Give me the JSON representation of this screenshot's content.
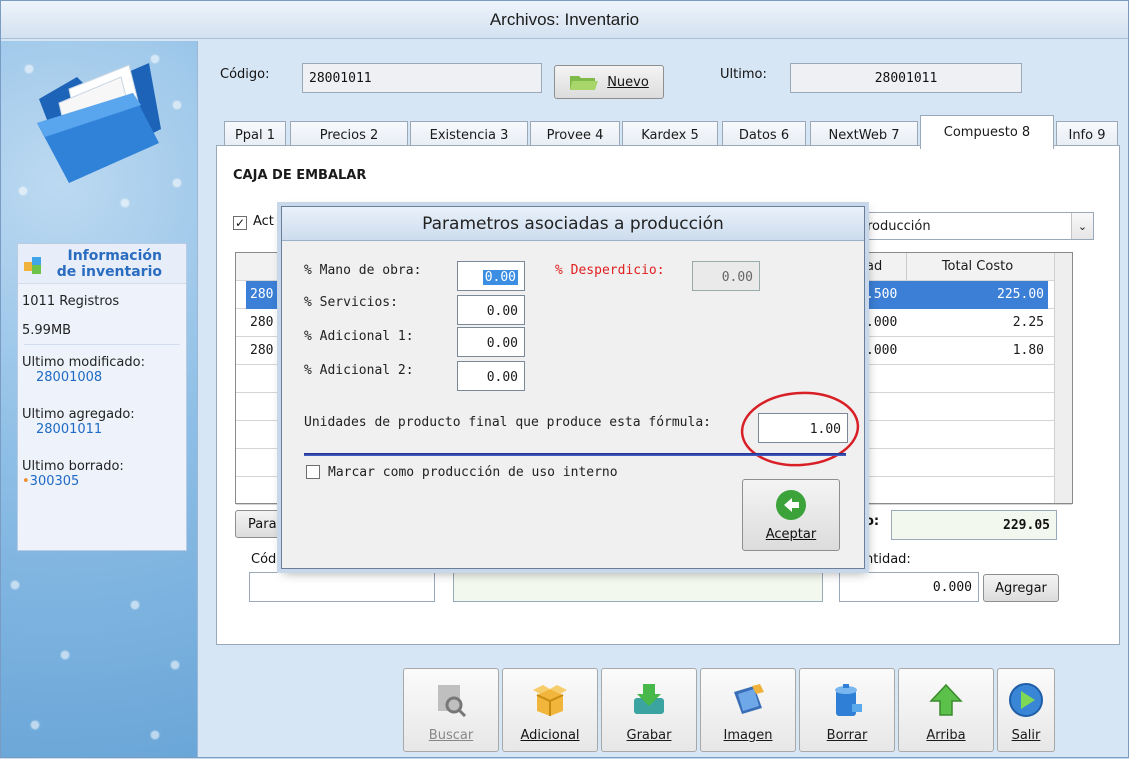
{
  "window": {
    "title": "Archivos: Inventario"
  },
  "sidebar": {
    "info_title_line1": "Información",
    "info_title_line2": "de inventario",
    "records": "1011 Registros",
    "size": "5.99MB",
    "last_modified_label": "Ultimo modificado:",
    "last_modified_value": "28001008",
    "last_added_label": "Ultimo agregado:",
    "last_added_value": "28001011",
    "last_deleted_label": "Ultimo borrado:",
    "last_deleted_value": "300305"
  },
  "header": {
    "code_label": "Código:",
    "code_value": "28001011",
    "new_button": "Nuevo",
    "last_label": "Ultimo:",
    "last_value": "28001011"
  },
  "tabs": [
    {
      "label": "Ppal 1"
    },
    {
      "label": "Precios 2"
    },
    {
      "label": "Existencia 3"
    },
    {
      "label": "Provee 4"
    },
    {
      "label": "Kardex 5"
    },
    {
      "label": "Datos 6"
    },
    {
      "label": "NextWeb 7"
    },
    {
      "label": "Compuesto 8"
    },
    {
      "label": "Info 9"
    }
  ],
  "tabpage": {
    "product_name": "CAJA DE EMBALAR",
    "active_checkbox_label": "Act",
    "dropdown_value": "roducción",
    "grid_headers": {
      "qty": "ad",
      "total": "Total Costo"
    },
    "grid_rows": [
      {
        "code": "280",
        "qty": ".500",
        "total": "225.00"
      },
      {
        "code": "280",
        "qty": ".000",
        "total": "2.25"
      },
      {
        "code": "280",
        "qty": ".000",
        "total": "1.80"
      }
    ],
    "param_button": "Parar",
    "total_label": "o:",
    "total_value": "229.05",
    "code_col_label": "Cód",
    "qty_col_label": "ntidad:",
    "qty_input_value": "0.000",
    "add_button": "Agregar"
  },
  "modal": {
    "title": "Parametros asociadas a producción",
    "labor_label": "% Mano de obra:",
    "labor_value": "0.00",
    "waste_label": "% Desperdicio:",
    "waste_value": "0.00",
    "services_label": "% Servicios:",
    "services_value": "0.00",
    "extra1_label": "% Adicional 1:",
    "extra1_value": "0.00",
    "extra2_label": "% Adicional 2:",
    "extra2_value": "0.00",
    "units_label": "Unidades de producto final que produce esta fórmula:",
    "units_value": "1.00",
    "internal_use_label": "Marcar como producción de uso interno",
    "accept_button": "Aceptar",
    "colors": {
      "highlight_circle": "#d81f26",
      "waste_label": "#e02020",
      "separator": "#1b2c8a"
    }
  },
  "toolbar": [
    {
      "label": "Buscar",
      "icon": "search-icon"
    },
    {
      "label": "Adicional",
      "icon": "box-icon"
    },
    {
      "label": "Grabar",
      "icon": "save-icon"
    },
    {
      "label": "Imagen",
      "icon": "image-icon"
    },
    {
      "label": "Borrar",
      "icon": "trash-icon"
    },
    {
      "label": "Arriba",
      "icon": "arrow-up-icon"
    },
    {
      "label": "Salir",
      "icon": "play-icon"
    }
  ]
}
